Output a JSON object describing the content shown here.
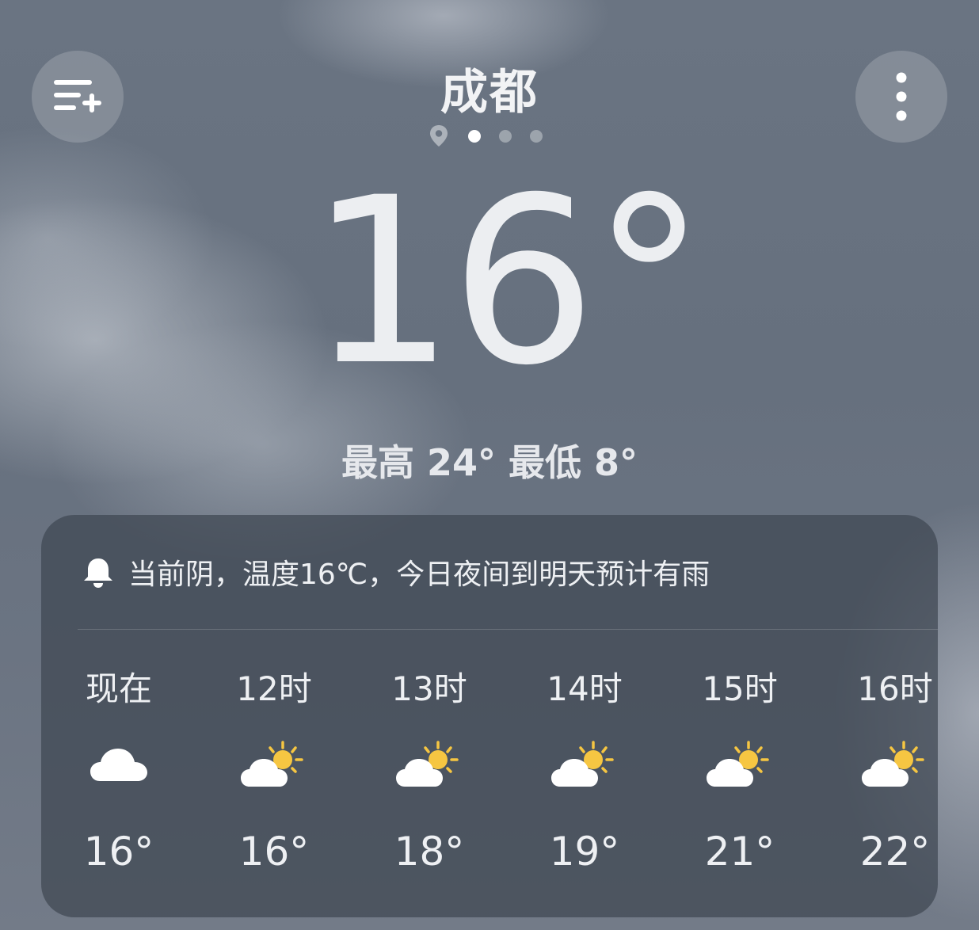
{
  "header": {
    "city": "成都",
    "add_city_icon": "list-add-icon",
    "more_icon": "more-vertical-icon"
  },
  "page_indicator": {
    "location_icon": "location-pin-icon",
    "pages": 3,
    "active_index": 0
  },
  "current": {
    "temperature": "16°",
    "hilo": "最高 24° 最低 8°"
  },
  "forecast_card": {
    "alert_icon": "bell-icon",
    "alert_text": "当前阴，温度16℃，今日夜间到明天预计有雨",
    "hours": [
      {
        "label": "现在",
        "icon": "cloudy-icon",
        "temp": "16°"
      },
      {
        "label": "12时",
        "icon": "partly-sunny-icon",
        "temp": "16°"
      },
      {
        "label": "13时",
        "icon": "partly-sunny-icon",
        "temp": "18°"
      },
      {
        "label": "14时",
        "icon": "partly-sunny-icon",
        "temp": "19°"
      },
      {
        "label": "15时",
        "icon": "partly-sunny-icon",
        "temp": "21°"
      },
      {
        "label": "16时",
        "icon": "partly-sunny-icon",
        "temp": "22°"
      }
    ]
  },
  "colors": {
    "text": "#eef0f3",
    "sun": "#f6c642",
    "cloud": "#ffffff"
  }
}
